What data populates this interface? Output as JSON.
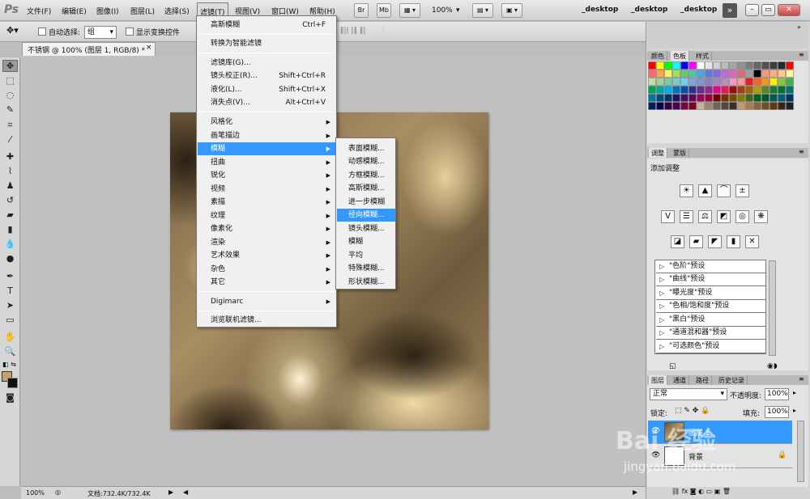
{
  "menubar": {
    "logo": "Ps",
    "items": [
      "文件(F)",
      "编辑(E)",
      "图像(I)",
      "图层(L)",
      "选择(S)",
      "滤镜(T)",
      "视图(V)",
      "窗口(W)",
      "帮助(H)"
    ],
    "toolbar": {
      "br": "Br",
      "mb": "Mb",
      "zoom": "100%"
    },
    "workspaces": [
      "_desktop",
      "_desktop",
      "_desktop"
    ],
    "more": "»"
  },
  "options": {
    "auto_select_label": "自动选择:",
    "auto_select_value": "组",
    "show_transform_label": "显示变换控件"
  },
  "document": {
    "tab_title": "不锈钢 @ 100% (图层 1, RGB/8) *",
    "close": "×"
  },
  "filter_menu": {
    "items": [
      {
        "label": "高斯模糊",
        "shortcut": "Ctrl+F"
      },
      {
        "label": "转换为智能滤镜",
        "shortcut": ""
      },
      {
        "label": "滤镜库(G)...",
        "shortcut": ""
      },
      {
        "label": "镜头校正(R)...",
        "shortcut": "Shift+Ctrl+R"
      },
      {
        "label": "液化(L)...",
        "shortcut": "Shift+Ctrl+X"
      },
      {
        "label": "消失点(V)...",
        "shortcut": "Alt+Ctrl+V"
      },
      {
        "label": "风格化",
        "shortcut": ""
      },
      {
        "label": "画笔描边",
        "shortcut": ""
      },
      {
        "label": "模糊",
        "shortcut": ""
      },
      {
        "label": "扭曲",
        "shortcut": ""
      },
      {
        "label": "锐化",
        "shortcut": ""
      },
      {
        "label": "视频",
        "shortcut": ""
      },
      {
        "label": "素描",
        "shortcut": ""
      },
      {
        "label": "纹理",
        "shortcut": ""
      },
      {
        "label": "像素化",
        "shortcut": ""
      },
      {
        "label": "渲染",
        "shortcut": ""
      },
      {
        "label": "艺术效果",
        "shortcut": ""
      },
      {
        "label": "杂色",
        "shortcut": ""
      },
      {
        "label": "其它",
        "shortcut": ""
      },
      {
        "label": "Digimarc",
        "shortcut": ""
      },
      {
        "label": "浏览联机滤镜...",
        "shortcut": ""
      }
    ],
    "submenu_arrow": "▶"
  },
  "blur_submenu": {
    "items": [
      "表面模糊...",
      "动感模糊...",
      "方框模糊...",
      "高斯模糊...",
      "进一步模糊",
      "径向模糊...",
      "镜头模糊...",
      "模糊",
      "平均",
      "特殊模糊...",
      "形状模糊..."
    ]
  },
  "status": {
    "zoom": "100%",
    "doc": "文档:732.4K/732.4K"
  },
  "panels": {
    "swatch_tabs": [
      "颜色",
      "色板",
      "样式"
    ],
    "adjust_tabs": [
      "调整",
      "蒙版"
    ],
    "adjust_title": "添加调整",
    "presets": [
      "\"色阶\"预设",
      "\"曲线\"预设",
      "\"曝光度\"预设",
      "\"色相/饱和度\"预设",
      "\"黑白\"预设",
      "\"通道混和器\"预设",
      "\"可选颜色\"预设"
    ],
    "layer_tabs": [
      "图层",
      "通道",
      "路径",
      "历史记录"
    ],
    "blend_mode": "正常",
    "opacity_label": "不透明度:",
    "opacity": "100%",
    "lock_label": "锁定:",
    "fill_label": "填充:",
    "fill": "100%",
    "layers": [
      "图层 1",
      "背景"
    ]
  },
  "watermark": {
    "brand": "Bai 经验",
    "url": "jingyan.baidu.com"
  }
}
